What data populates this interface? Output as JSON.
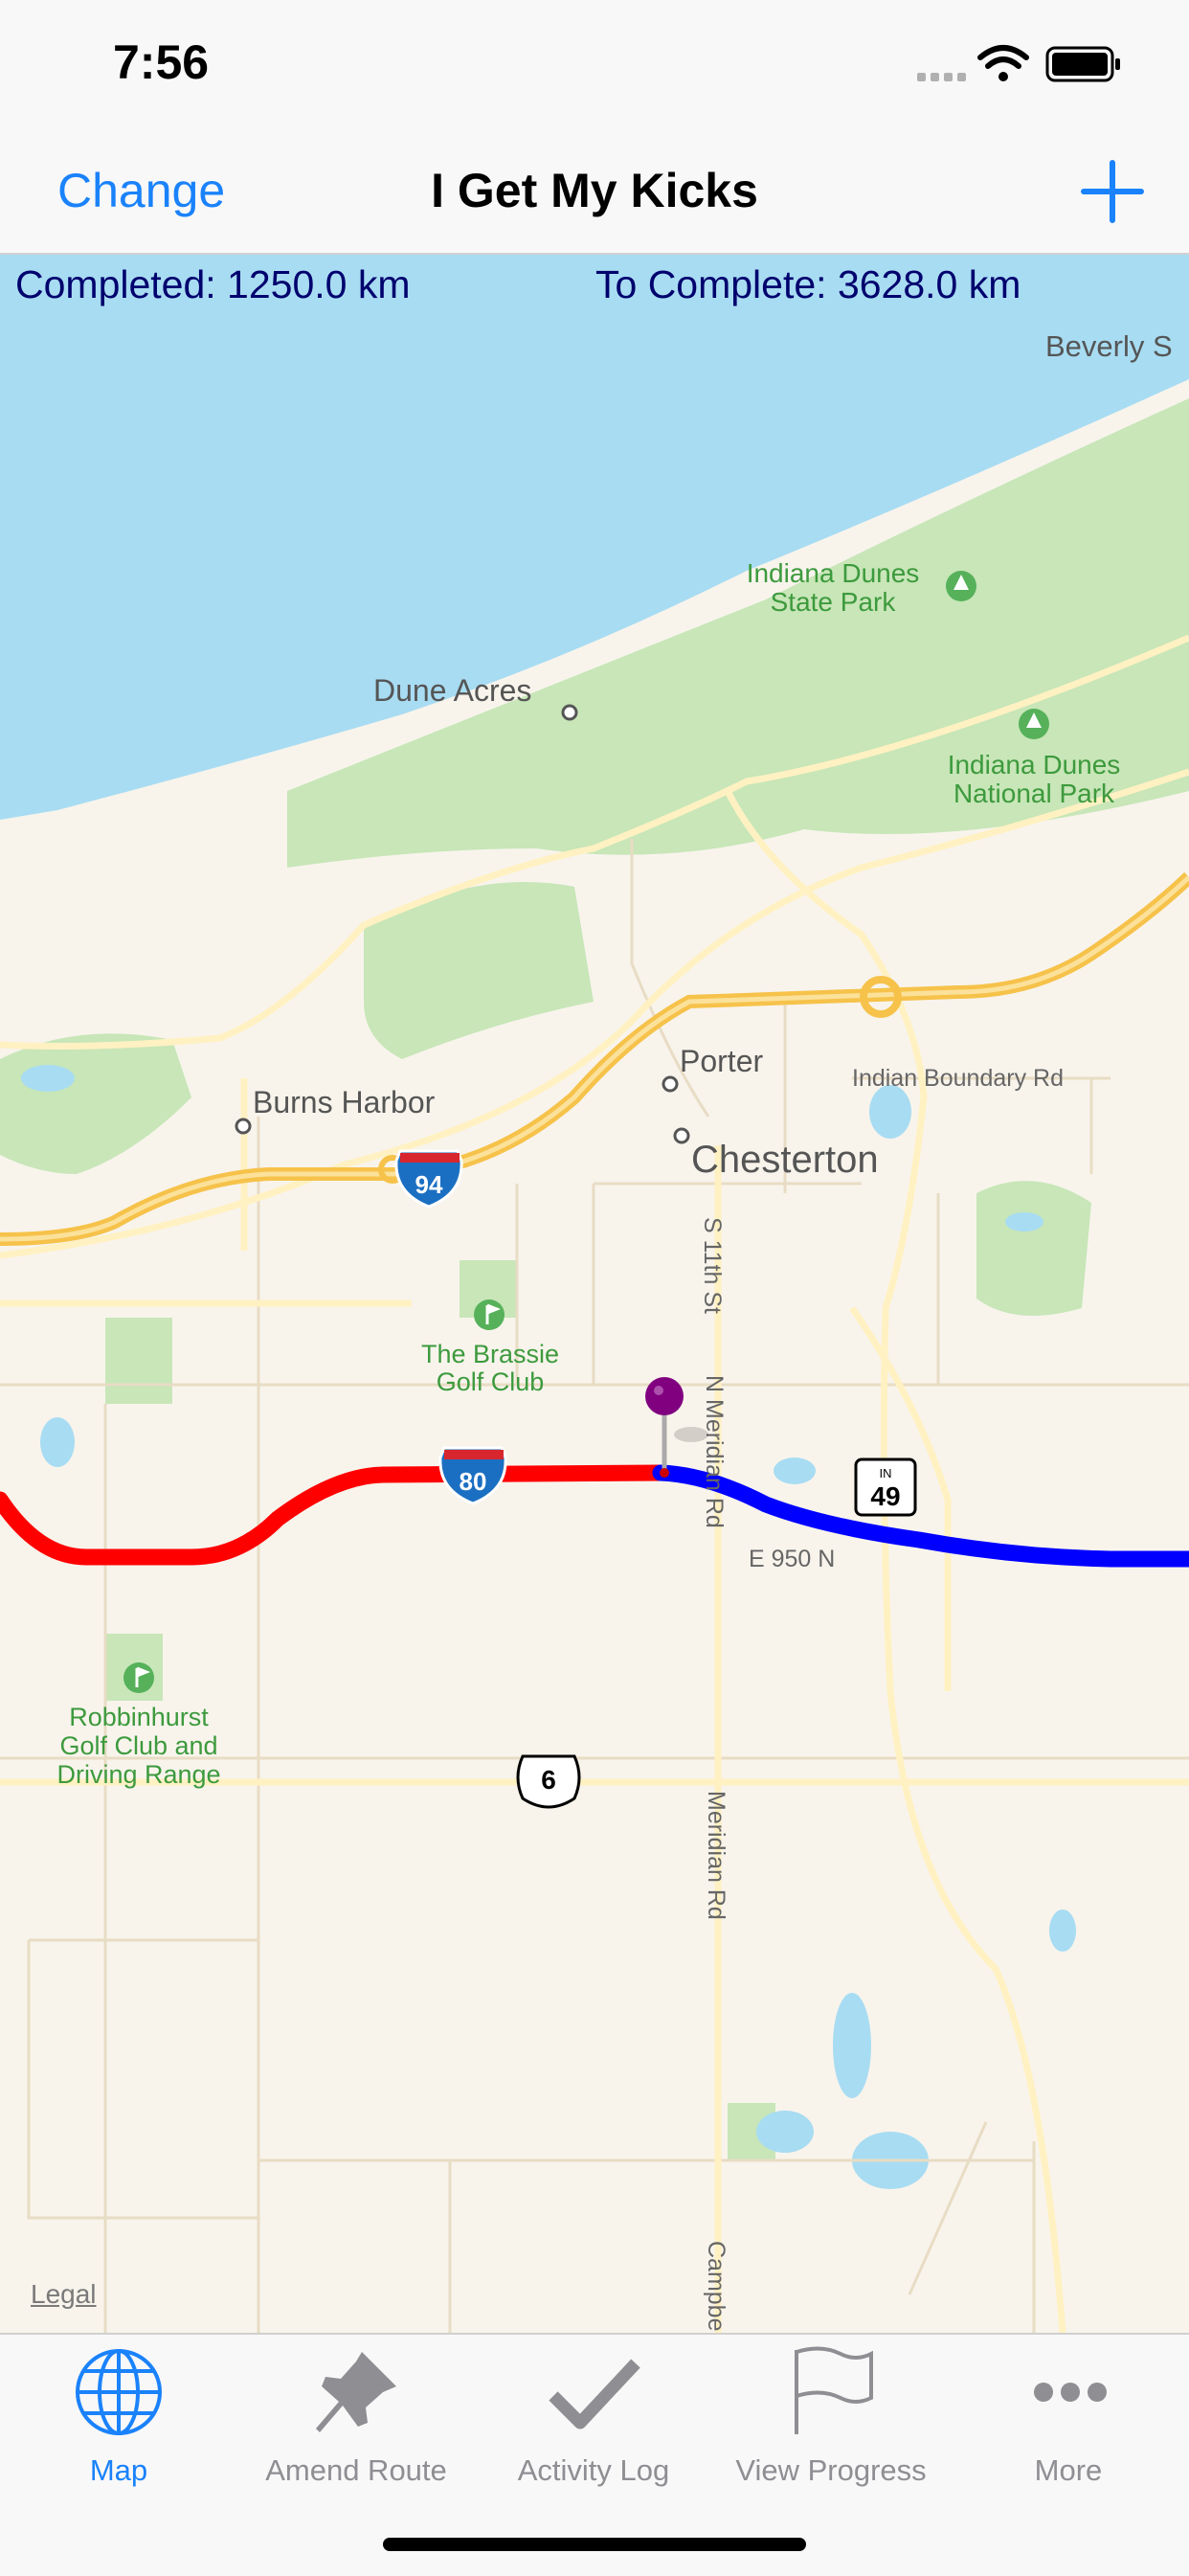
{
  "status_bar": {
    "time": "7:56",
    "icons": [
      "signal-icon",
      "wifi-icon",
      "battery-icon"
    ]
  },
  "nav": {
    "left_button": "Change",
    "title": "I Get My Kicks",
    "right_icon": "plus-icon"
  },
  "stats": {
    "completed": "Completed: 1250.0 km",
    "to_complete": "To Complete: 3628.0 km"
  },
  "map": {
    "places": {
      "beverly": "Beverly S",
      "indiana_dunes_state_park_1": "Indiana Dunes",
      "indiana_dunes_state_park_2": "State Park",
      "dune_acres": "Dune Acres",
      "indiana_dunes_np_1": "Indiana Dunes",
      "indiana_dunes_np_2": "National Park",
      "porter": "Porter",
      "indian_boundary_rd": "Indian Boundary Rd",
      "burns_harbor": "Burns Harbor",
      "chesterton": "Chesterton",
      "s_11th_st": "S 11th St",
      "brassie_1": "The Brassie",
      "brassie_2": "Golf Club",
      "n_meridian_rd": "N Meridian Rd",
      "e_950_n": "E 950 N",
      "robbinhurst_1": "Robbinhurst",
      "robbinhurst_2": "Golf Club and",
      "robbinhurst_3": "Driving Range",
      "meridian_rd": "Meridian Rd",
      "campbell": "Campbe"
    },
    "shields": {
      "i94": "94",
      "i80": "80",
      "us6": "6",
      "in49_top": "IN",
      "in49": "49"
    },
    "legal": "Legal",
    "route_colors": {
      "completed": "#ff0000",
      "remaining": "#0000ff",
      "pin": "#800080"
    }
  },
  "tabs": [
    {
      "label": "Map",
      "icon": "globe-icon",
      "active": true
    },
    {
      "label": "Amend Route",
      "icon": "pin-icon",
      "active": false
    },
    {
      "label": "Activity Log",
      "icon": "checkmark-icon",
      "active": false
    },
    {
      "label": "View Progress",
      "icon": "flag-icon",
      "active": false
    },
    {
      "label": "More",
      "icon": "more-icon",
      "active": false
    }
  ],
  "colors": {
    "accent": "#1a82fb",
    "inactive": "#8e8e93",
    "stat_text": "#00006e"
  }
}
